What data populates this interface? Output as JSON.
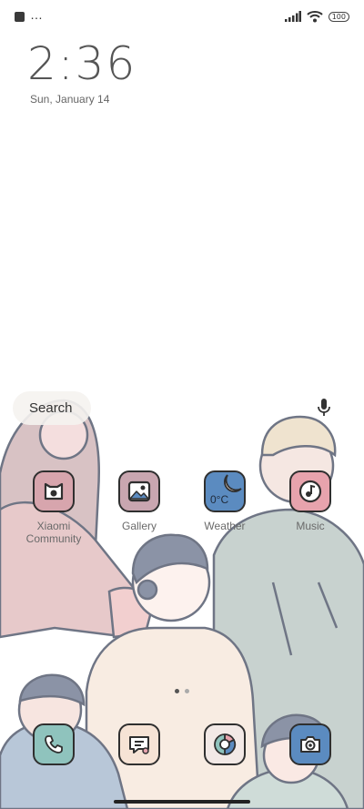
{
  "status_bar": {
    "left_icons": [
      "notification-square-icon",
      "more-dots-icon"
    ],
    "more_dots": "…",
    "right_icons": [
      "signal-icon",
      "wifi-icon",
      "battery-icon"
    ],
    "battery_level": "100"
  },
  "lockclock": {
    "time": "2:36",
    "date": "Sun, January 14"
  },
  "search": {
    "placeholder": "Search",
    "mic_icon": "mic-icon"
  },
  "apps": [
    {
      "label": "Xiaomi Community",
      "icon": "xiaomi-community-icon",
      "color": "#d7a5ad"
    },
    {
      "label": "Gallery",
      "icon": "gallery-icon",
      "color": "#c9a6b0"
    },
    {
      "label": "Weather",
      "icon": "weather-icon",
      "color": "#5b8bc0",
      "value": "0°C"
    },
    {
      "label": "Music",
      "icon": "music-icon",
      "color": "#e7a3ad"
    }
  ],
  "dock": [
    {
      "icon": "phone-icon",
      "color": "#8fc3bd"
    },
    {
      "icon": "messages-icon",
      "color": "#f6e3d5"
    },
    {
      "icon": "browser-icon",
      "color": "#f2e9e6"
    },
    {
      "icon": "camera-icon",
      "color": "#5b8bc0"
    }
  ],
  "pager": {
    "total": 2,
    "active": 1
  }
}
